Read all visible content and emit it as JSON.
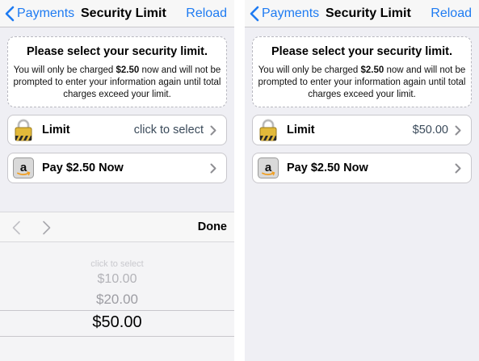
{
  "colors": {
    "accent": "#1e7bf2",
    "background": "#efeff4",
    "lock_gold": "#e2b93a",
    "lock_shackle": "#cfcfcf"
  },
  "icons": {
    "back": "chevron-left-icon",
    "row_arrow": "chevron-right-icon",
    "limit": "padlock-icon",
    "pay": "amazon-logo-icon",
    "prev": "chevron-left-icon",
    "next": "chevron-right-icon"
  },
  "left": {
    "nav": {
      "back_label": "Payments",
      "title": "Security Limit",
      "reload": "Reload"
    },
    "notice": {
      "title": "Please select your security limit.",
      "line_pre": "You will only be charged ",
      "amount": "$2.50",
      "line_post": " now and will not be prompted to enter your information again until total charges exceed your limit."
    },
    "limit_row": {
      "label": "Limit",
      "value": "click to select"
    },
    "pay_row": {
      "label": "Pay $2.50 Now"
    },
    "toolbar": {
      "done": "Done"
    },
    "picker": {
      "options": [
        "click to select",
        "$10.00",
        "$20.00",
        "$50.00"
      ],
      "selected": "$50.00"
    }
  },
  "right": {
    "nav": {
      "back_label": "Payments",
      "title": "Security Limit",
      "reload": "Reload"
    },
    "notice": {
      "title": "Please select your security limit.",
      "line_pre": "You will only be charged ",
      "amount": "$2.50",
      "line_post": " now and will not be prompted to enter your information again until total charges exceed your limit."
    },
    "limit_row": {
      "label": "Limit",
      "value": "$50.00"
    },
    "pay_row": {
      "label": "Pay $2.50 Now"
    }
  }
}
